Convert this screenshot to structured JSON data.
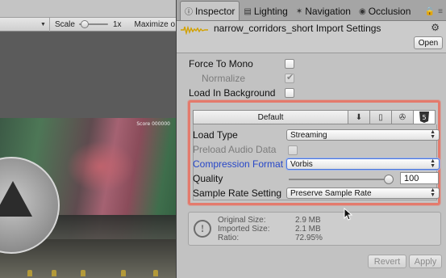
{
  "game_view": {
    "toolbar": {
      "scale_label": "Scale",
      "scale_value": "1x",
      "maximize_label": "Maximize o"
    },
    "score_text": "Score 000000"
  },
  "inspector": {
    "tabs": [
      {
        "label": "Inspector",
        "icon": "info-icon",
        "active": true
      },
      {
        "label": "Lighting",
        "icon": "lighting-icon",
        "active": false
      },
      {
        "label": "Navigation",
        "icon": "navigation-icon",
        "active": false
      },
      {
        "label": "Occlusion",
        "icon": "occlusion-icon",
        "active": false
      }
    ],
    "asset_title": "narrow_corridors_short Import Settings",
    "open_label": "Open",
    "properties": {
      "force_to_mono": {
        "label": "Force To Mono",
        "checked": false
      },
      "normalize": {
        "label": "Normalize",
        "checked": true,
        "disabled": true
      },
      "load_in_background": {
        "label": "Load In Background",
        "checked": false
      }
    },
    "platform": {
      "default_label": "Default",
      "buttons": [
        "download-icon",
        "phone-icon",
        "android-icon",
        "html5-icon"
      ]
    },
    "settings": {
      "load_type": {
        "label": "Load Type",
        "value": "Streaming"
      },
      "preload_audio_data": {
        "label": "Preload Audio Data",
        "checked": false,
        "disabled": true
      },
      "compression_format": {
        "label": "Compression Format",
        "value": "Vorbis"
      },
      "quality": {
        "label": "Quality",
        "value": "100",
        "fraction": 1.0
      },
      "sample_rate_setting": {
        "label": "Sample Rate Setting",
        "value": "Preserve Sample Rate"
      }
    },
    "info": {
      "original_size_label": "Original Size:",
      "original_size_value": "2.9 MB",
      "imported_size_label": "Imported Size:",
      "imported_size_value": "2.1 MB",
      "ratio_label": "Ratio:",
      "ratio_value": "72.95%"
    },
    "revert_label": "Revert",
    "apply_label": "Apply"
  },
  "colors": {
    "highlight_border": "#e47a6c",
    "focused_label": "#2747c8",
    "panel_bg": "#c2c2c2"
  }
}
